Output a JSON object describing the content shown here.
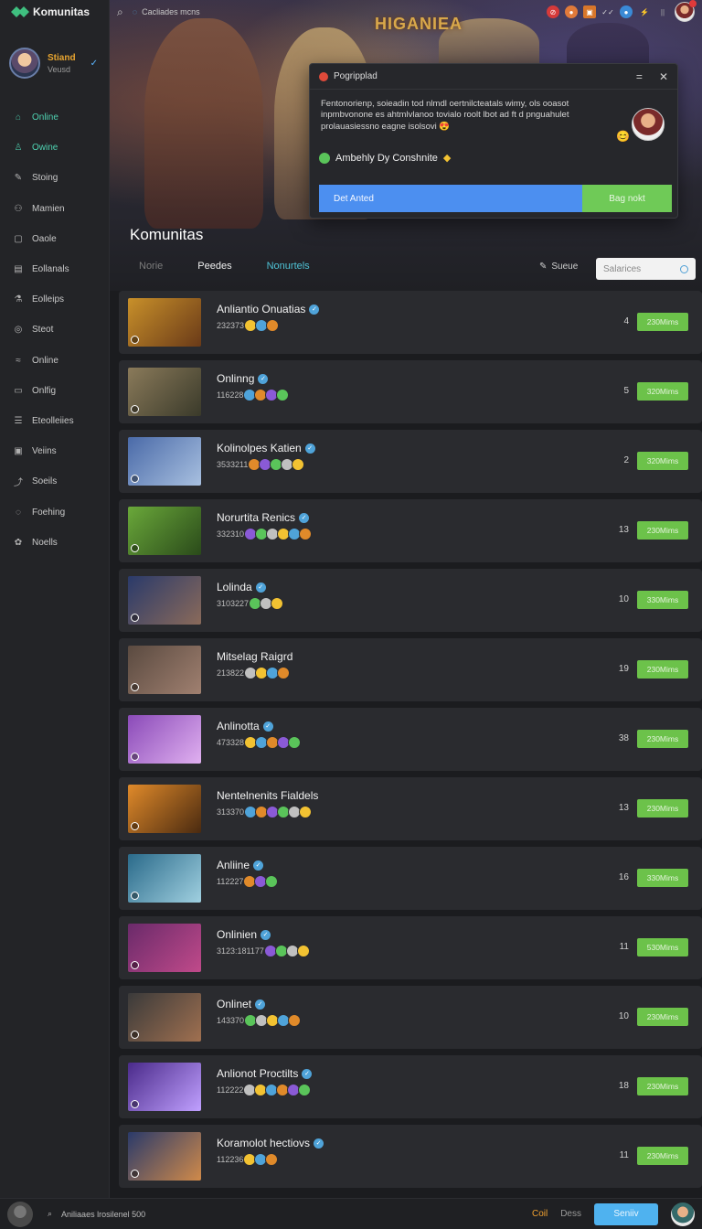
{
  "app": {
    "title": "Komunitas"
  },
  "profile": {
    "name": "Stiand",
    "sub": "Veusd"
  },
  "sidebar": {
    "items": [
      {
        "label": "Online",
        "icon": "home-icon"
      },
      {
        "label": "Owine",
        "icon": "user-icon"
      },
      {
        "label": "Stoing",
        "icon": "pen-icon"
      },
      {
        "label": "Mamien",
        "icon": "users-icon"
      },
      {
        "label": "Oaole",
        "icon": "camera-icon"
      },
      {
        "label": "Eollanals",
        "icon": "book-icon"
      },
      {
        "label": "Eolleips",
        "icon": "flask-icon"
      },
      {
        "label": "Steot",
        "icon": "record-icon"
      },
      {
        "label": "Online",
        "icon": "chart-icon"
      },
      {
        "label": "Onlfig",
        "icon": "monitor-icon"
      },
      {
        "label": "Eteolleiies",
        "icon": "list-icon"
      },
      {
        "label": "Veiins",
        "icon": "tv-icon"
      },
      {
        "label": "Soeils",
        "icon": "trend-icon"
      },
      {
        "label": "Foehing",
        "icon": "chat-icon"
      },
      {
        "label": "Noells",
        "icon": "gear-icon"
      }
    ]
  },
  "topbar": {
    "search_text": "Cacliades mcns"
  },
  "hero": {
    "art_title": "HIGANIEA",
    "section_title": "Komunitas"
  },
  "tabs": [
    {
      "label": "Norie"
    },
    {
      "label": "Peedes"
    },
    {
      "label": "Nonurtels"
    }
  ],
  "sort_label": "Sueue",
  "filter": {
    "placeholder": "Salarices"
  },
  "popup": {
    "title": "Pogripplad",
    "body": "Fentonorienp, soieadin tod nlmdl oertnilcteatals wimy, ols ooasot inpmbvonone es ahtmlvlanoo tovialo roolt lbot ad ft d pnguahulet prolauasiessno eagne isolsovi 😍",
    "subline": "Ambehly Dy Conshnite",
    "primary_button": "Det Anted",
    "secondary_button": "Bag nokt",
    "colors": {
      "primary": "#4c8ff0",
      "secondary": "#6fca57"
    }
  },
  "communities": [
    {
      "title": "Anliantio Onuatias",
      "meta": "232373",
      "count": "4",
      "join": "230Mims",
      "verified": true
    },
    {
      "title": "Onlinng",
      "meta": "116228",
      "count": "5",
      "join": "320Mims",
      "verified": true
    },
    {
      "title": "Kolinolpes Katien",
      "meta": "3533211",
      "count": "2",
      "join": "320Mims",
      "verified": true
    },
    {
      "title": "Norurtita Renics",
      "meta": "332310",
      "count": "13",
      "join": "230Mims",
      "verified": true
    },
    {
      "title": "Lolinda",
      "meta": "3103227",
      "count": "10",
      "join": "330Mims",
      "verified": true
    },
    {
      "title": "Mitselag Raigrd",
      "meta": "213822",
      "count": "19",
      "join": "230Mims",
      "verified": false
    },
    {
      "title": "Anlinotta",
      "meta": "473328",
      "count": "38",
      "join": "230Mims",
      "verified": true
    },
    {
      "title": "Nentelnenits Fialdels",
      "meta": "313370",
      "count": "13",
      "join": "230Mims",
      "verified": false
    },
    {
      "title": "Anliine",
      "meta": "112227",
      "count": "16",
      "join": "330Mims",
      "verified": true
    },
    {
      "title": "Onlinien",
      "meta": "3123:181177",
      "count": "11",
      "join": "530Mims",
      "verified": true
    },
    {
      "title": "Onlinet",
      "meta": "143370",
      "count": "10",
      "join": "230Mims",
      "verified": true
    },
    {
      "title": "Anlionot Proctilts",
      "meta": "112222",
      "count": "18",
      "join": "230Mims",
      "verified": true
    },
    {
      "title": "Koramolot hectiovs",
      "meta": "112236",
      "count": "11",
      "join": "230Mims",
      "verified": true
    }
  ],
  "bottombar": {
    "search_text": "Aniliaaes lrosilenel 500",
    "link_a": "Coil",
    "link_b": "Dess",
    "send": "Seniiv"
  }
}
